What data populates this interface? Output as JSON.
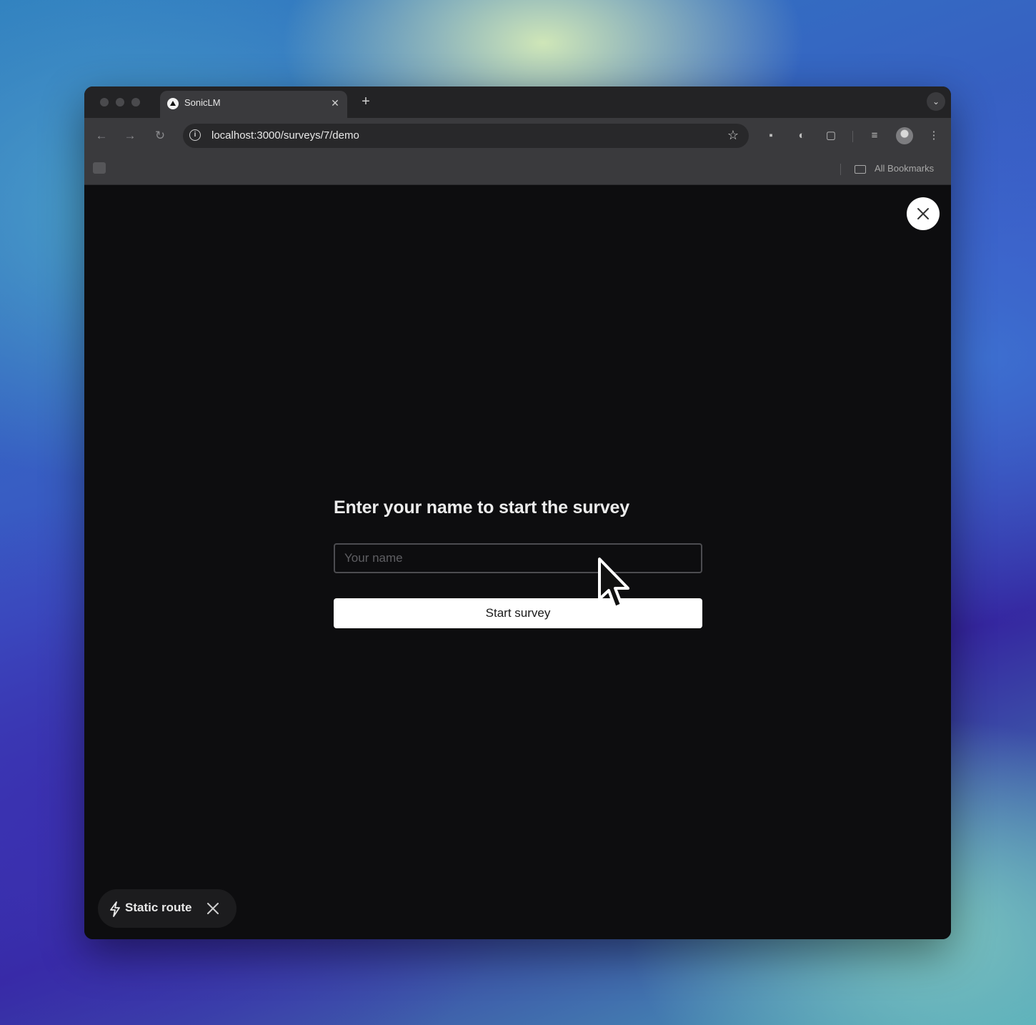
{
  "browser": {
    "tab": {
      "title": "SonicLM"
    },
    "address_bar": {
      "url": "localhost:3000/surveys/7/demo"
    },
    "bookmarks_bar": {
      "all_bookmarks_label": "All Bookmarks"
    }
  },
  "page": {
    "heading": "Enter your name to start the survey",
    "name_input": {
      "placeholder": "Your name",
      "value": ""
    },
    "start_button_label": "Start survey"
  },
  "dev_badge": {
    "label": "Static route"
  }
}
